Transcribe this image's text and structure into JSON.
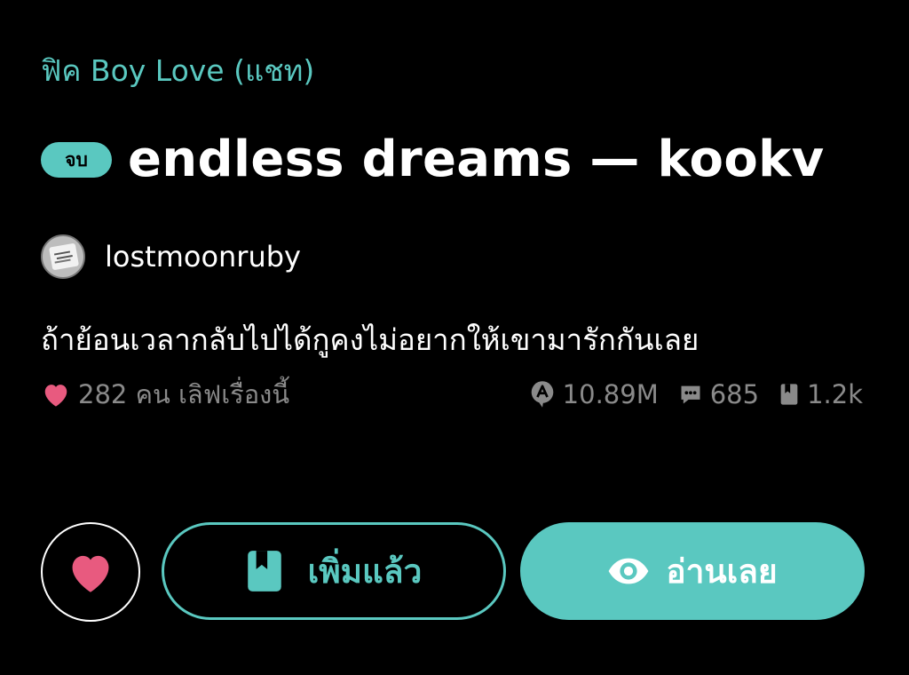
{
  "category": "ฟิค Boy Love (แชท)",
  "story": {
    "status_badge": "จบ",
    "title": "endless dreams — kookv",
    "author": "lostmoonruby",
    "description": "ถ้าย้อนเวลากลับไปได้กูคงไม่อยากให้เขามารักกันเลย"
  },
  "loves": {
    "count_text": "282 คน เลิฟเรื่องนี้",
    "icon": "heart-icon"
  },
  "stats": {
    "views": "10.89M",
    "comments": "685",
    "bookmarks": "1.2k"
  },
  "actions": {
    "library_label": "เพิ่มแล้ว",
    "read_label": "อ่านเลย"
  },
  "colors": {
    "accent": "#5ac8c0",
    "heart": "#e85a7f",
    "muted": "#8a8a8a",
    "background": "#000000"
  }
}
